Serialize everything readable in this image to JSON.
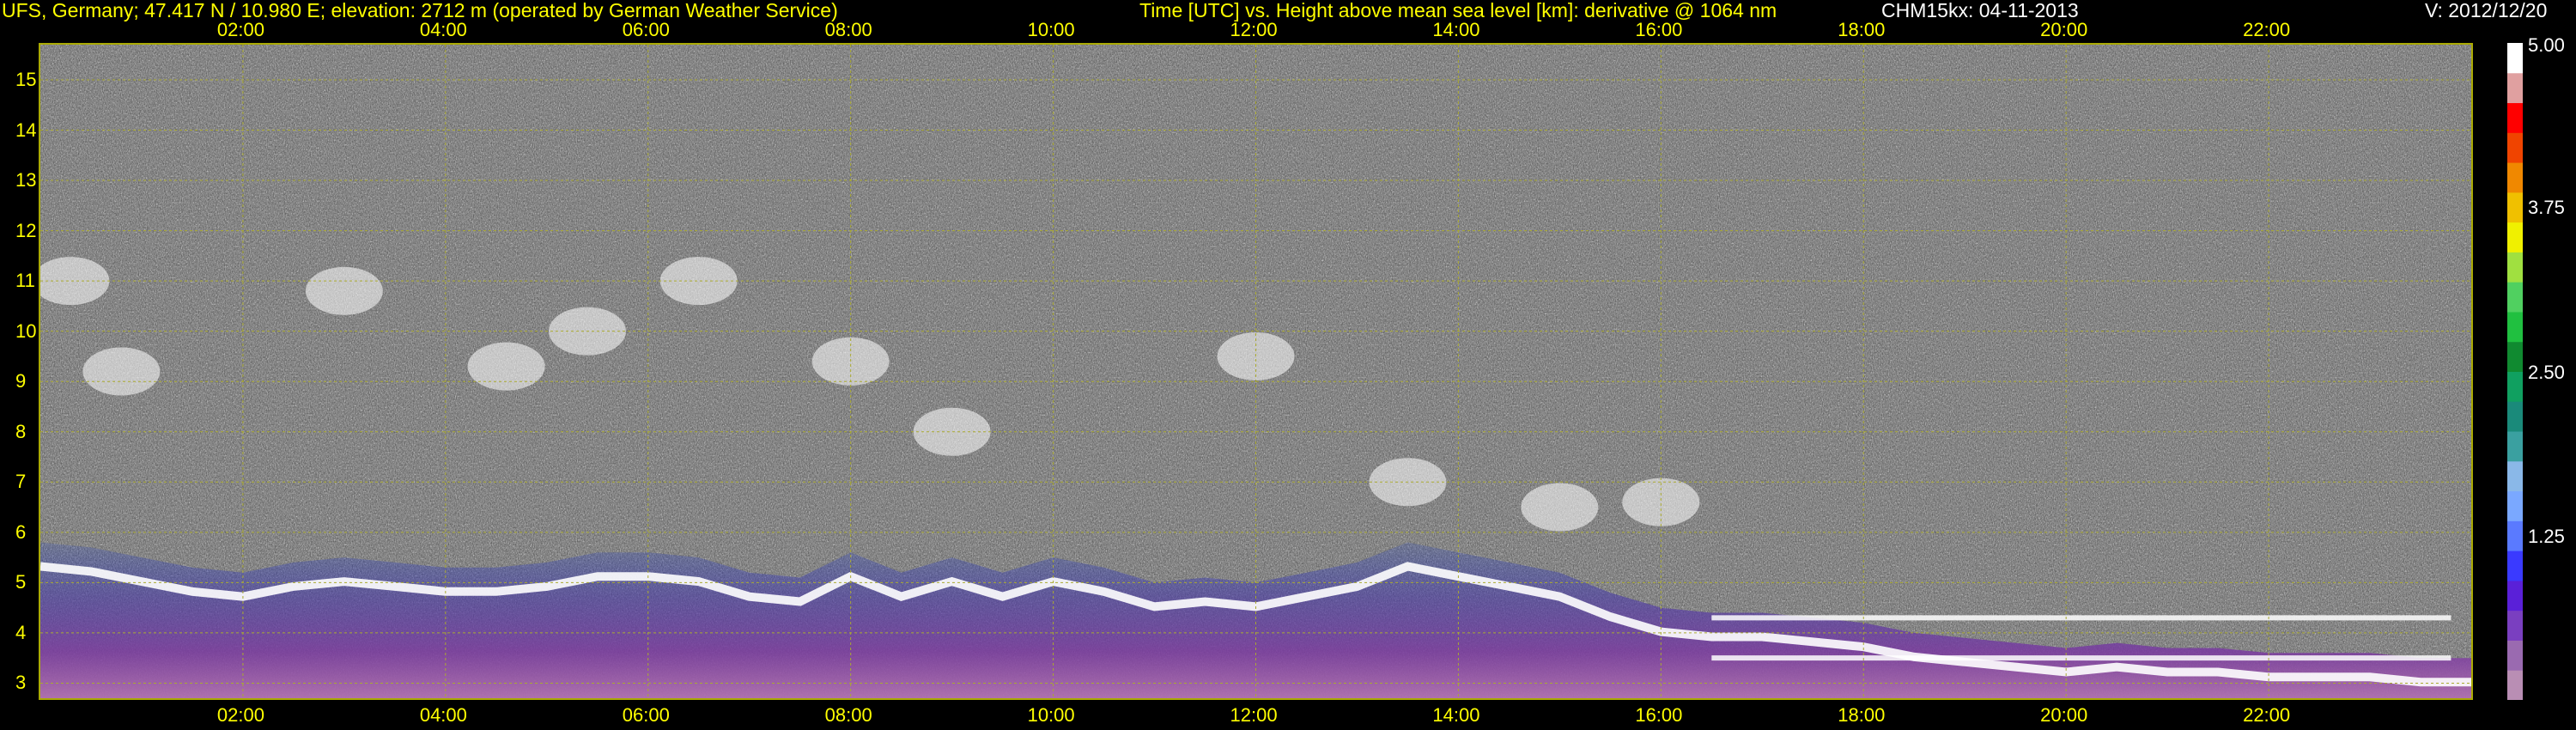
{
  "header": {
    "station": "UFS, Germany; 47.417 N / 10.980 E; elevation: 2712 m  (operated by German Weather Service)",
    "description": "Time [UTC] vs. Height above mean sea level [km]: derivative @ 1064 nm",
    "instrument": "CHM15kx: 04-11-2013",
    "version": "V: 2012/12/20"
  },
  "chart_data": {
    "type": "heatmap",
    "title": "Time [UTC] vs. Height above mean sea level [km]: derivative @ 1064 nm",
    "xlabel": "Time [UTC]",
    "ylabel": "Height above mean sea level [km]",
    "x_ticks": [
      "02:00",
      "04:00",
      "06:00",
      "08:00",
      "10:00",
      "12:00",
      "14:00",
      "16:00",
      "18:00",
      "20:00",
      "22:00"
    ],
    "x_tick_hours": [
      2,
      4,
      6,
      8,
      10,
      12,
      14,
      16,
      18,
      20,
      22
    ],
    "xlim": [
      0,
      24
    ],
    "y_ticks": [
      "3",
      "4",
      "5",
      "6",
      "7",
      "8",
      "9",
      "10",
      "11",
      "12",
      "13",
      "14",
      "15"
    ],
    "y_tick_values": [
      3,
      4,
      5,
      6,
      7,
      8,
      9,
      10,
      11,
      12,
      13,
      14,
      15
    ],
    "ylim": [
      2.7,
      15.7
    ],
    "grid": true,
    "colorbar": {
      "ticks": [
        "1.25",
        "2.50",
        "3.75",
        "5.00"
      ],
      "tick_values": [
        1.25,
        2.5,
        3.75,
        5.0
      ],
      "range": [
        0,
        5
      ],
      "colors": [
        "#b98eb4",
        "#9a6ab0",
        "#7a3fc0",
        "#5a20d8",
        "#3a3aff",
        "#5a7aff",
        "#7aa8ff",
        "#8ab8e8",
        "#3aa0a0",
        "#1a8a7a",
        "#10a060",
        "#108a30",
        "#20c040",
        "#50d060",
        "#a0e040",
        "#f0f000",
        "#f0c000",
        "#f08800",
        "#f04400",
        "#ff0000",
        "#e0a0a0",
        "#ffffff"
      ]
    },
    "features": {
      "layer_times": [
        0.0,
        0.5,
        1.0,
        1.5,
        2.0,
        2.5,
        3.0,
        3.5,
        4.0,
        4.5,
        5.0,
        5.5,
        6.0,
        6.5,
        7.0,
        7.5,
        8.0,
        8.5,
        9.0,
        9.5,
        10.0,
        10.5,
        11.0,
        11.5,
        12.0,
        12.5,
        13.0,
        13.5,
        14.0,
        14.5,
        15.0,
        15.5,
        16.0,
        16.5,
        17.0,
        17.5,
        18.0,
        18.5,
        19.0,
        19.5,
        20.0,
        20.5,
        21.0,
        21.5,
        22.0,
        22.5,
        23.0,
        23.5,
        24.0
      ],
      "layer_tops_km": [
        5.8,
        5.7,
        5.5,
        5.3,
        5.2,
        5.4,
        5.5,
        5.4,
        5.3,
        5.3,
        5.4,
        5.6,
        5.6,
        5.5,
        5.2,
        5.1,
        5.6,
        5.2,
        5.5,
        5.2,
        5.5,
        5.3,
        5.0,
        5.1,
        5.0,
        5.2,
        5.4,
        5.8,
        5.6,
        5.4,
        5.2,
        4.8,
        4.5,
        4.4,
        4.4,
        4.3,
        4.2,
        4.0,
        3.9,
        3.8,
        3.7,
        3.8,
        3.7,
        3.7,
        3.6,
        3.6,
        3.6,
        3.5,
        3.5
      ],
      "high_cloud_blobs_hours_km": [
        [
          0.3,
          11.0
        ],
        [
          0.8,
          9.2
        ],
        [
          3.0,
          10.8
        ],
        [
          4.6,
          9.3
        ],
        [
          5.4,
          10.0
        ],
        [
          6.5,
          11.0
        ],
        [
          8.0,
          9.4
        ],
        [
          9.0,
          8.0
        ],
        [
          12.0,
          9.5
        ],
        [
          13.5,
          7.0
        ],
        [
          15.0,
          6.5
        ],
        [
          16.0,
          6.6
        ]
      ],
      "low_bright_bands_km": [
        4.3,
        3.5
      ]
    }
  }
}
